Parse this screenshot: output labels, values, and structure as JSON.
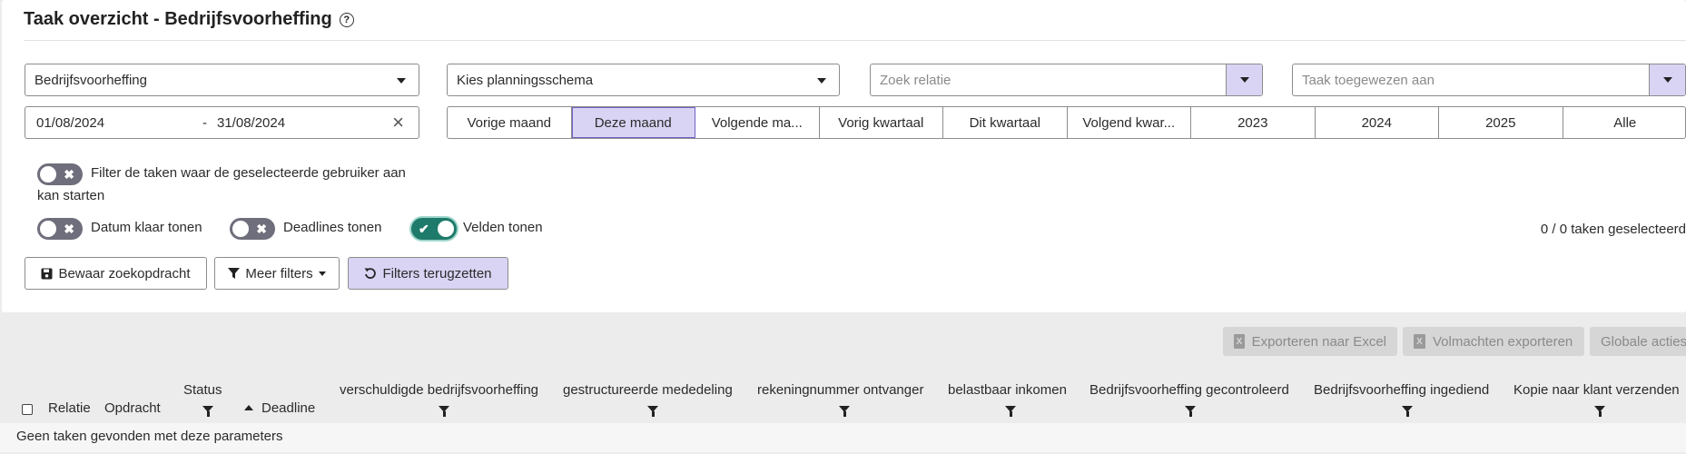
{
  "header": {
    "title": "Taak overzicht - Bedrijfsvoorheffing",
    "help_icon": "question-circle-icon"
  },
  "filters": {
    "task_type": {
      "value": "Bedrijfsvoorheffing"
    },
    "planning_schema": {
      "value": "Kies planningsschema"
    },
    "relation_search": {
      "placeholder": "Zoek relatie"
    },
    "assigned_to": {
      "placeholder": "Taak toegewezen aan"
    },
    "date_range": {
      "from": "01/08/2024",
      "separator": "-",
      "to": "31/08/2024",
      "clear_icon": "close-icon"
    },
    "periods": [
      {
        "label": "Vorige maand",
        "active": false
      },
      {
        "label": "Deze maand",
        "active": true
      },
      {
        "label": "Volgende ma...",
        "active": false
      },
      {
        "label": "Vorig kwartaal",
        "active": false
      },
      {
        "label": "Dit kwartaal",
        "active": false
      },
      {
        "label": "Volgend kwar...",
        "active": false
      },
      {
        "label": "2023",
        "active": false
      },
      {
        "label": "2024",
        "active": false
      },
      {
        "label": "2025",
        "active": false
      },
      {
        "label": "Alle",
        "active": false
      }
    ],
    "toggles": {
      "filter_startable": {
        "label_line1": "Filter de taken waar de geselecteerde gebruiker aan",
        "label_line2": "kan starten",
        "on": false
      },
      "show_done_date": {
        "label": "Datum klaar tonen",
        "on": false
      },
      "show_deadlines": {
        "label": "Deadlines tonen",
        "on": false
      },
      "show_fields": {
        "label": "Velden tonen",
        "on": true
      }
    },
    "selected_count": "0 / 0 taken geselecteerd",
    "actions": {
      "save_search": "Bewaar zoekopdracht",
      "more_filters": "Meer filters",
      "reset_filters": "Filters terugzetten"
    }
  },
  "toolbar": {
    "export_excel": "Exporteren naar Excel",
    "export_mandates": "Volmachten exporteren",
    "global_actions": "Globale acties"
  },
  "table": {
    "columns": {
      "relatie": "Relatie",
      "opdracht": "Opdracht",
      "status": "Status",
      "deadline": "Deadline",
      "verschuldigde": "verschuldigde bedrijfsvoorheffing",
      "mededeling": "gestructureerde mededeling",
      "rekeningnummer": "rekeningnummer ontvanger",
      "belastbaar": "belastbaar inkomen",
      "gecontroleerd": "Bedrijfsvoorheffing gecontroleerd",
      "ingediend": "Bedrijfsvoorheffing ingediend",
      "kopie": "Kopie naar klant verzenden"
    },
    "empty_message": "Geen taken gevonden met deze parameters"
  },
  "colors": {
    "accent": "#d9d4f4",
    "accent_border": "#6e63c6",
    "toggle_on": "#1e7a6a",
    "toggle_off": "#6e6e7c"
  }
}
